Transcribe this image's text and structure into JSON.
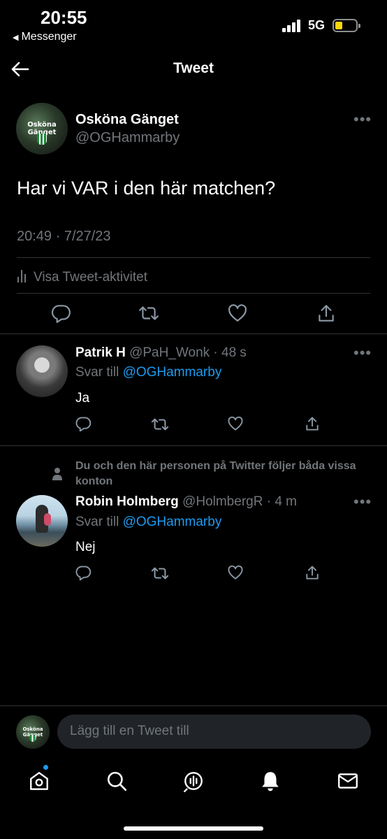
{
  "status_bar": {
    "time": "20:55",
    "back_app": "Messenger",
    "network": "5G",
    "battery_color": "#ffd60a"
  },
  "header": {
    "title": "Tweet",
    "back_icon": "arrow-left-icon"
  },
  "main_tweet": {
    "avatar_text": "Osköna Gänget",
    "author_name": "Osköna Gänget",
    "handle": "@OGHammarby",
    "text": "Har vi VAR i den här matchen?",
    "timestamp": "20:49 · 7/27/23",
    "activity_label": "Visa Tweet-aktivitet",
    "actions": [
      "reply-icon",
      "retweet-icon",
      "like-icon",
      "share-icon"
    ]
  },
  "replies": [
    {
      "name": "Patrik H",
      "handle_time": "@PaH_Wonk · 48 s",
      "reply_prefix": "Svar till",
      "reply_mention": "@OGHammarby",
      "text": "Ja"
    },
    {
      "social_context": "Du och den här personen på Twitter följer båda vissa konton",
      "name": "Robin Holmberg",
      "handle_time": "@HolmbergR · 4 m",
      "reply_prefix": "Svar till",
      "reply_mention": "@OGHammarby",
      "text": "Nej"
    }
  ],
  "composer": {
    "avatar_text": "Osköna Gänget",
    "placeholder": "Lägg till en Tweet till"
  },
  "tab_bar": {
    "items": [
      "home-icon",
      "search-icon",
      "spaces-icon",
      "notifications-icon",
      "messages-icon"
    ],
    "accent": "#1d9bf0"
  }
}
